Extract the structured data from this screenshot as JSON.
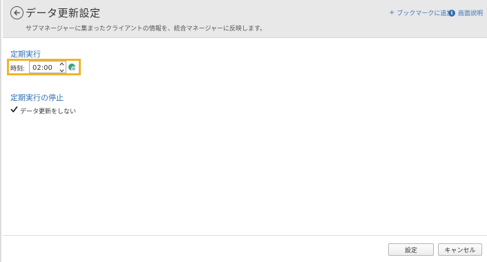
{
  "header": {
    "title": "データ更新設定",
    "subtitle": "サブマネージャーに集まったクライアントの情報を、統合マネージャーに反映します。",
    "bookmark_link": "ブックマークに追加",
    "bookmark_prefix": "+",
    "help_link": "画面説明",
    "help_icon_text": "i"
  },
  "schedule": {
    "section_title": "定期実行",
    "time_label": "時刻:",
    "time_value": "02:00"
  },
  "stop": {
    "section_title": "定期実行の停止",
    "checkbox_label": "データ更新をしない",
    "checked": true
  },
  "footer": {
    "ok_label": "設定",
    "cancel_label": "キャンセル"
  },
  "colors": {
    "accent": "#2f6fb5",
    "highlight": "#f0b429",
    "header_bg": "#e8e8e8"
  }
}
